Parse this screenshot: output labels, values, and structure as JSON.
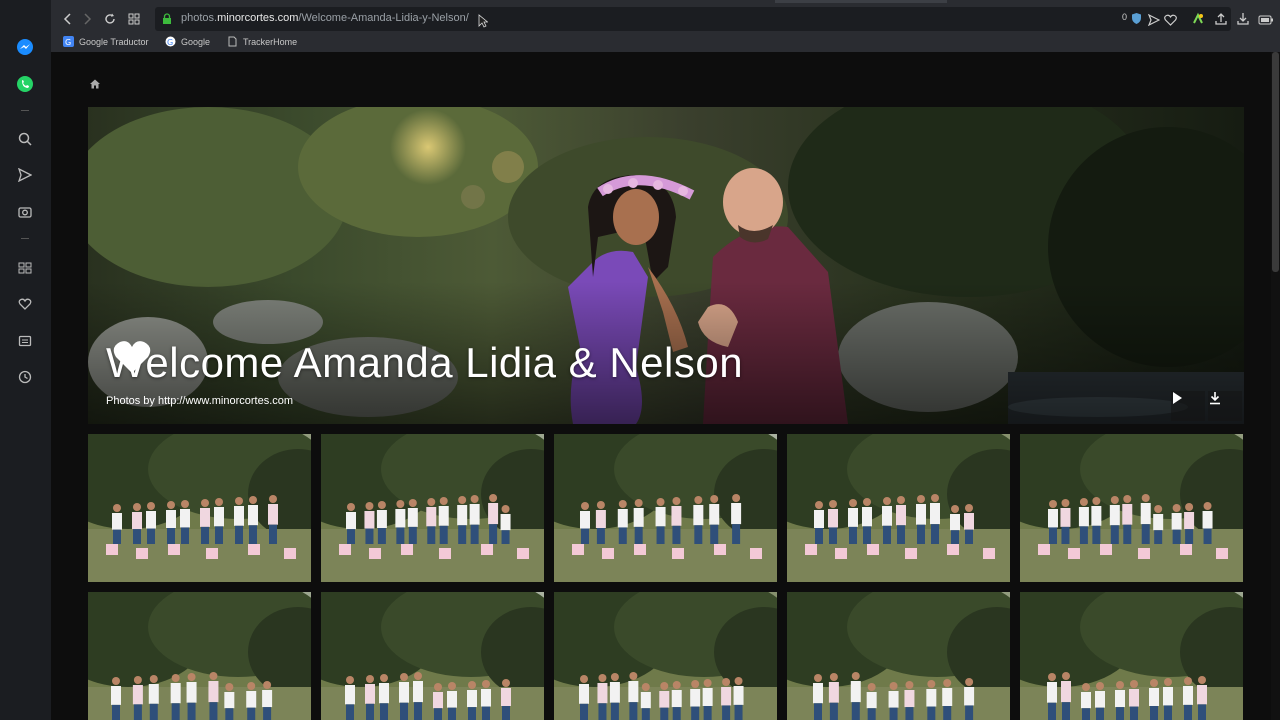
{
  "browser": {
    "url_prefix": "photos.",
    "url_domain": "minorcortes.com",
    "url_path": "/Welcome-Amanda-Lidia-y-Nelson/",
    "badge_count": "0",
    "bookmarks": [
      {
        "label": "Google Traductor",
        "icon": "translate-icon"
      },
      {
        "label": "Google",
        "icon": "google-icon"
      },
      {
        "label": "TrackerHome",
        "icon": "page-icon"
      }
    ]
  },
  "sidebar": {
    "items": [
      {
        "name": "messenger-icon"
      },
      {
        "name": "whatsapp-icon"
      },
      {
        "name": "search-icon"
      },
      {
        "name": "send-icon"
      },
      {
        "name": "camera-icon"
      },
      {
        "name": "speed-dial-icon"
      },
      {
        "name": "heart-icon"
      },
      {
        "name": "news-icon"
      },
      {
        "name": "history-icon"
      }
    ]
  },
  "gallery": {
    "title": "Welcome Amanda ♥ Lidia & Nelson",
    "title_part1": "Welcome Amanda",
    "title_part2": "Lidia & Nelson",
    "subtitle": "Photos by http://www.minorcortes.com",
    "thumbnails_row1": 5,
    "thumbnails_row2": 5,
    "colors": {
      "background": "#0d0d0d",
      "sky": "#cfd6da",
      "grass": "#6f7a4a"
    }
  }
}
